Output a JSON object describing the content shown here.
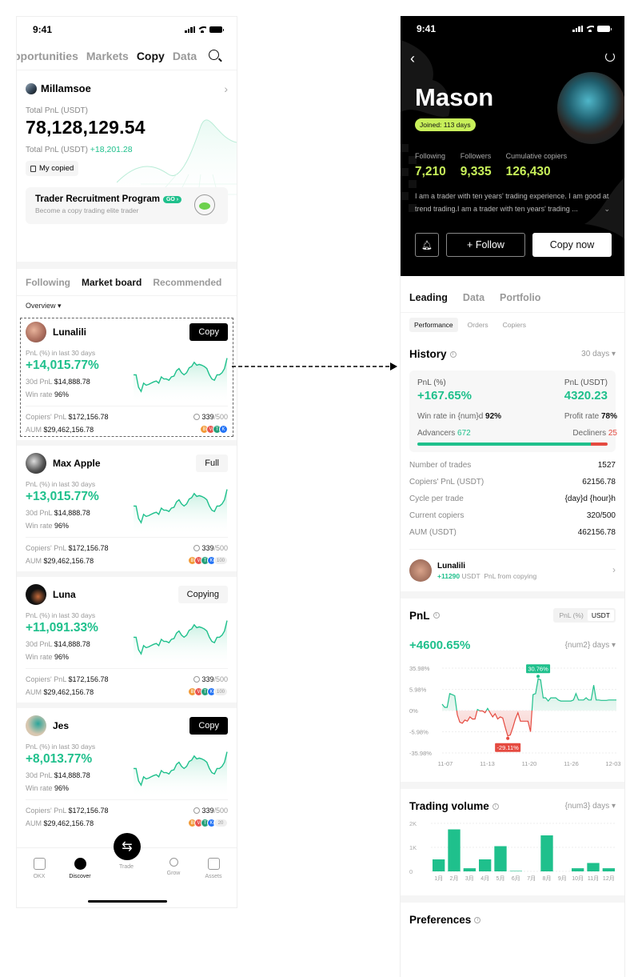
{
  "left": {
    "status": {
      "time": "9:41"
    },
    "topnav": [
      {
        "label": "pportunities",
        "active": false
      },
      {
        "label": "Markets",
        "active": false
      },
      {
        "label": "Copy",
        "active": true
      },
      {
        "label": "Data",
        "active": false
      }
    ],
    "account": {
      "username": "Millamsoe",
      "total_pnl_label": "Total PnL (USDT)",
      "total_pnl": "78,128,129.54",
      "sub_label": "Total PnL (USDT)",
      "sub_value": "+18,201.28",
      "my_copied": "My copied"
    },
    "recruit": {
      "title": "Trader Recruitment Program",
      "go": "GO ›",
      "subtitle": "Become a copy trading elite trader"
    },
    "subtabs": [
      {
        "label": "Following"
      },
      {
        "label": "Market board"
      },
      {
        "label": "Recommended"
      }
    ],
    "overview": "Overview ▾",
    "traders": [
      {
        "name": "Lunalili",
        "button": "Copy",
        "button_style": "dark",
        "pnl_label": "PnL (%) in last 30 days",
        "pnl_pct": "+14,015.77%",
        "pnl30_label": "30d PnL",
        "pnl30": "$14,888.78",
        "winrate_label": "Win rate",
        "winrate": "96%",
        "copiers_pnl_label": "Copiers' PnL",
        "copiers_pnl": "$172,156.78",
        "aum_label": "AUM",
        "aum": "$29,462,156.78",
        "copiers": "339",
        "copiers_max": "/500",
        "extra_coins": ""
      },
      {
        "name": "Max Apple",
        "button": "Full",
        "button_style": "gray",
        "pnl_label": "PnL (%) in last 30 days",
        "pnl_pct": "+13,015.77%",
        "pnl30_label": "30d PnL",
        "pnl30": "$14,888.78",
        "winrate_label": "Win rate",
        "winrate": "96%",
        "copiers_pnl_label": "Copiers' PnL",
        "copiers_pnl": "$172,156.78",
        "aum_label": "AUM",
        "aum": "$29,462,156.78",
        "copiers": "339",
        "copiers_max": "/500",
        "extra_coins": "100"
      },
      {
        "name": "Luna",
        "button": "Copying",
        "button_style": "gray",
        "pnl_label": "PnL (%) in last 30 days",
        "pnl_pct": "+11,091.33%",
        "pnl30_label": "30d PnL",
        "pnl30": "$14,888.78",
        "winrate_label": "Win rate",
        "winrate": "96%",
        "copiers_pnl_label": "Copiers' PnL",
        "copiers_pnl": "$172,156.78",
        "aum_label": "AUM",
        "aum": "$29,462,156.78",
        "copiers": "339",
        "copiers_max": "/500",
        "extra_coins": "100"
      },
      {
        "name": "Jes",
        "button": "Copy",
        "button_style": "dark",
        "pnl_label": "PnL (%) in last 30 days",
        "pnl_pct": "+8,013.77%",
        "pnl30_label": "30d PnL",
        "pnl30": "$14,888.78",
        "winrate_label": "Win rate",
        "winrate": "96%",
        "copiers_pnl_label": "Copiers' PnL",
        "copiers_pnl": "$172,156.78",
        "aum_label": "AUM",
        "aum": "$29,462,156.78",
        "copiers": "339",
        "copiers_max": "/500",
        "extra_coins": "20"
      }
    ],
    "coins": [
      {
        "letter": "B",
        "color": "#f29a38"
      },
      {
        "letter": "V",
        "color": "#e8554e"
      },
      {
        "letter": "T",
        "color": "#26a17b"
      },
      {
        "letter": "K",
        "color": "#2373f5"
      }
    ],
    "tabbar": [
      {
        "label": "OKX",
        "icon": "home-icon"
      },
      {
        "label": "Discover",
        "icon": "discover-icon",
        "active": true
      },
      {
        "label": "Trade",
        "icon": "swap-icon"
      },
      {
        "label": "Grow",
        "icon": "grow-icon"
      },
      {
        "label": "Assets",
        "icon": "wallet-icon"
      }
    ]
  },
  "right": {
    "status": {
      "time": "9:41"
    },
    "profile": {
      "name": "Mason",
      "joined": "Joined: 113 days",
      "stats": [
        {
          "label": "Following",
          "value": "7,210"
        },
        {
          "label": "Followers",
          "value": "9,335"
        },
        {
          "label": "Cumulative copiers",
          "value": "126,430"
        }
      ],
      "bio": "I am a trader with ten years' trading experience. I am good at trend trading.I am a trader with ten years' trading ...",
      "follow": "+ Follow",
      "copy_now": "Copy now"
    },
    "tabs": [
      {
        "label": "Leading"
      },
      {
        "label": "Data"
      },
      {
        "label": "Portfolio"
      }
    ],
    "pills": [
      {
        "label": "Performance"
      },
      {
        "label": "Orders"
      },
      {
        "label": "Copiers"
      }
    ],
    "history": {
      "title": "History",
      "range": "30 days ▾",
      "pnl_pct_label": "PnL (%)",
      "pnl_pct": "+167.65%",
      "pnl_usdt_label": "PnL (USDT)",
      "pnl_usdt": "4320.23",
      "winrate_label": "Win rate in {num}d",
      "winrate": "92%",
      "profit_label": "Profit rate",
      "profit": "78%",
      "adv_label": "Advancers",
      "adv": "672",
      "dec_label": "Decliners",
      "dec": "25",
      "adv_fraction": 0.91
    },
    "kv": [
      {
        "k": "Number of trades",
        "v": "1527"
      },
      {
        "k": "Copiers' PnL (USDT)",
        "v": "62156.78"
      },
      {
        "k": "Cycle per trade",
        "v": "{day}d {hour}h"
      },
      {
        "k": "Current copiers",
        "v": "320/500"
      },
      {
        "k": "AUM (USDT)",
        "v": "462156.78"
      }
    ],
    "copier": {
      "name": "Lunalili",
      "amount": "+11290",
      "unit": "USDT",
      "desc": "PnL from copying"
    },
    "pnl": {
      "title": "PnL",
      "toggle": [
        "PnL (%)",
        "USDT"
      ],
      "value": "+4600.65%",
      "range": "{num2} days ▾"
    },
    "volume": {
      "title": "Trading volume",
      "range": "{num3} days ▾"
    },
    "preferences": {
      "title": "Preferences"
    }
  },
  "chart_data": [
    {
      "type": "line",
      "title": "PnL",
      "x": [
        "11-07",
        "11-13",
        "11-20",
        "11-26",
        "12-03"
      ],
      "yticks": [
        "35.98%",
        "5.98%",
        "0%",
        "-5.98%",
        "-35.98%"
      ],
      "max_label": "30.76%",
      "min_label": "-29.11%",
      "series": [
        {
          "name": "PnL",
          "values": [
            0.3,
            0.15,
            0.15,
            0.8,
            0.75,
            0.7,
            -0.2,
            -0.55,
            -0.6,
            -0.45,
            -0.5,
            -0.3,
            -0.4,
            -0.4,
            0.05,
            -0.02,
            -0.02,
            -0.1,
            0.1,
            -0.1,
            -0.3,
            -0.15,
            -0.4,
            -0.3,
            -0.35,
            -0.8,
            -1.2,
            -1.15,
            -0.8,
            -0.4,
            -0.1,
            -0.5,
            -0.5,
            -0.5,
            -0.5,
            -1.0,
            0.75,
            0.8,
            1.5,
            1.45,
            0.6,
            0.6,
            0.45,
            0.6,
            0.6,
            0.6,
            0.5,
            0.45,
            0.45,
            0.45,
            0.45,
            0.45,
            0.5,
            0.8,
            0.5,
            0.5,
            0.5,
            0.6,
            0.5,
            0.5,
            1.2,
            0.5,
            0.5,
            0.48,
            0.48,
            0.48,
            0.5,
            0.5,
            0.5,
            0.5
          ]
        }
      ],
      "ylim": [
        -2,
        2
      ]
    },
    {
      "type": "bar",
      "title": "Trading volume",
      "categories": [
        "1月",
        "2月",
        "3月",
        "4月",
        "5月",
        "6月",
        "7月",
        "8月",
        "9月",
        "10月",
        "11月",
        "12月"
      ],
      "values": [
        500,
        1750,
        130,
        500,
        1050,
        20,
        0,
        1500,
        0,
        130,
        350,
        130
      ],
      "yticks": [
        "2K",
        "1K",
        "0"
      ],
      "ylim": [
        0,
        2000
      ]
    },
    {
      "type": "line",
      "title": "30d PnL sparkline",
      "series": [
        {
          "name": "spark",
          "values": [
            0.55,
            0.55,
            0.25,
            0.15,
            0.35,
            0.3,
            0.32,
            0.35,
            0.38,
            0.4,
            0.35,
            0.5,
            0.45,
            0.45,
            0.42,
            0.5,
            0.52,
            0.65,
            0.7,
            0.6,
            0.55,
            0.6,
            0.72,
            0.75,
            0.85,
            0.78,
            0.8,
            0.78,
            0.75,
            0.7,
            0.55,
            0.45,
            0.42,
            0.55,
            0.55,
            0.6,
            0.7,
            0.95
          ]
        }
      ]
    }
  ]
}
